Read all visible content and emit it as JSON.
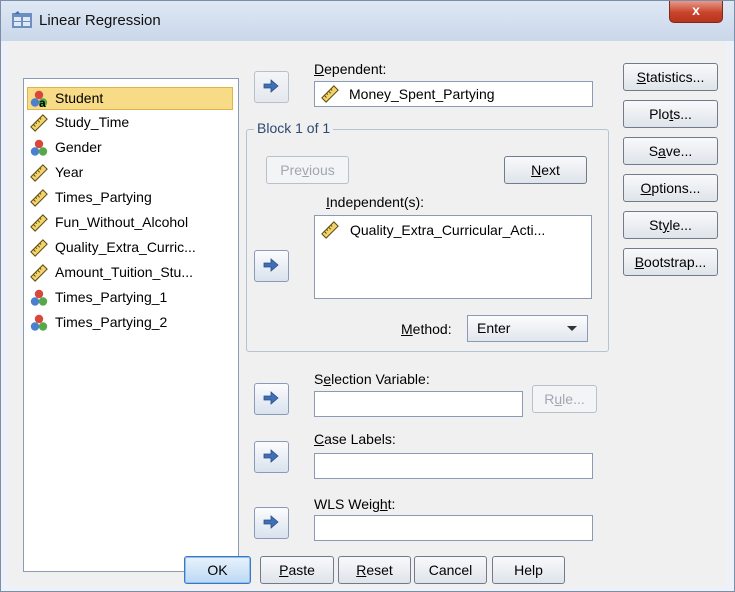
{
  "window": {
    "title": "Linear Regression",
    "close_label": "x"
  },
  "variables": [
    {
      "label": "Student",
      "type": "nominal",
      "selected": true
    },
    {
      "label": "Study_Time",
      "type": "scale",
      "selected": false
    },
    {
      "label": "Gender",
      "type": "nominal",
      "selected": false
    },
    {
      "label": "Year",
      "type": "scale",
      "selected": false
    },
    {
      "label": "Times_Partying",
      "type": "scale",
      "selected": false
    },
    {
      "label": "Fun_Without_Alcohol",
      "type": "scale",
      "selected": false
    },
    {
      "label": "Quality_Extra_Curric...",
      "type": "scale",
      "selected": false
    },
    {
      "label": "Amount_Tuition_Stu...",
      "type": "scale",
      "selected": false
    },
    {
      "label": "Times_Partying_1",
      "type": "nominal",
      "selected": false
    },
    {
      "label": "Times_Partying_2",
      "type": "nominal",
      "selected": false
    }
  ],
  "dependent": {
    "label_pre": "",
    "label_key": "D",
    "label_post": "ependent:",
    "value": "Money_Spent_Partying"
  },
  "block": {
    "title": "Block 1 of 1",
    "previous": {
      "pre": "Pre",
      "key": "v",
      "post": "ious"
    },
    "next": {
      "pre": "",
      "key": "N",
      "post": "ext"
    },
    "independents_label": {
      "pre": "",
      "key": "I",
      "post": "ndependent(s):"
    },
    "independents": [
      "Quality_Extra_Curricular_Acti..."
    ],
    "method_label": {
      "pre": "",
      "key": "M",
      "post": "ethod:"
    },
    "method_value": "Enter"
  },
  "selection_variable": {
    "pre": "S",
    "key": "e",
    "post": "lection Variable:",
    "value": ""
  },
  "rule_button": {
    "pre": "R",
    "key": "u",
    "post": "le..."
  },
  "case_labels": {
    "pre": "",
    "key": "C",
    "post": "ase Labels:",
    "value": ""
  },
  "wls_weight": {
    "pre": "WLS Weig",
    "key": "h",
    "post": "t:",
    "value": ""
  },
  "side_buttons": [
    {
      "pre": "",
      "key": "S",
      "post": "tatistics..."
    },
    {
      "pre": "Plo",
      "key": "t",
      "post": "s..."
    },
    {
      "pre": "S",
      "key": "a",
      "post": "ve..."
    },
    {
      "pre": "",
      "key": "O",
      "post": "ptions..."
    },
    {
      "pre": "St",
      "key": "y",
      "post": "le..."
    },
    {
      "pre": "",
      "key": "B",
      "post": "ootstrap..."
    }
  ],
  "bottom_buttons": {
    "ok": "OK",
    "paste": {
      "pre": "",
      "key": "P",
      "post": "aste"
    },
    "reset": {
      "pre": "",
      "key": "R",
      "post": "eset"
    },
    "cancel": "Cancel",
    "help": "Help"
  },
  "colors": {
    "selection_bg": "#f8db86",
    "arrow_blue": "#3f6fb5",
    "title_text": "#2e4a6e",
    "close_red": "#c9432c"
  }
}
